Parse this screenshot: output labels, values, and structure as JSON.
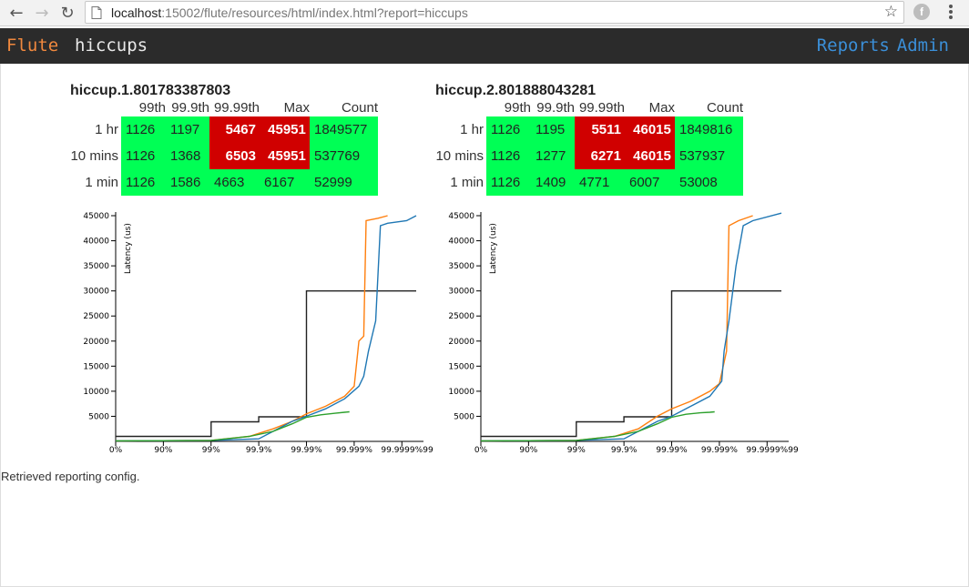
{
  "browser": {
    "url_host": "localhost",
    "url_rest": ":15002/flute/resources/html/index.html?report=hiccups",
    "ext_icon_glyph": "f"
  },
  "navbar": {
    "brand": "Flute",
    "report_name": "hiccups",
    "links": [
      "Reports",
      "Admin"
    ]
  },
  "stats_headers": [
    "99th",
    "99.9th",
    "99.99th",
    "Max",
    "Count"
  ],
  "panels": [
    {
      "title": "hiccup.1.801783387803",
      "rows": [
        {
          "label": "1 hr",
          "p99": "1126",
          "p999": "1197",
          "p9999": "5467",
          "max": "45951",
          "count": "1849577",
          "alarm": true
        },
        {
          "label": "10 mins",
          "p99": "1126",
          "p999": "1368",
          "p9999": "6503",
          "max": "45951",
          "count": "537769",
          "alarm": true
        },
        {
          "label": "1 min",
          "p99": "1126",
          "p999": "1586",
          "p9999": "4663",
          "max": "6167",
          "count": "52999",
          "alarm": false
        }
      ]
    },
    {
      "title": "hiccup.2.801888043281",
      "rows": [
        {
          "label": "1 hr",
          "p99": "1126",
          "p999": "1195",
          "p9999": "5511",
          "max": "46015",
          "count": "1849816",
          "alarm": true
        },
        {
          "label": "10 mins",
          "p99": "1126",
          "p999": "1277",
          "p9999": "6271",
          "max": "46015",
          "count": "537937",
          "alarm": true
        },
        {
          "label": "1 min",
          "p99": "1126",
          "p999": "1409",
          "p9999": "4771",
          "max": "6007",
          "count": "53008",
          "alarm": false
        }
      ]
    }
  ],
  "status_message": "Retrieved reporting config.",
  "colors": {
    "ok": "#00ff55",
    "alarm": "#d00000",
    "series_1hr": "#1f77b4",
    "series_10min": "#ff7f0e",
    "series_1min": "#2ca02c",
    "sla": "#222222"
  },
  "chart_data": [
    {
      "type": "line",
      "title": "",
      "ylabel": "Latency (us)",
      "x_scale": "log-percentile",
      "x_ticks": [
        "0%",
        "90%",
        "99%",
        "99.9%",
        "99.99%",
        "99.999%",
        "99.9999%",
        "99"
      ],
      "y_ticks": [
        5000,
        10000,
        15000,
        20000,
        25000,
        30000,
        35000,
        40000,
        45000
      ],
      "ylim": [
        0,
        45000
      ],
      "series": [
        {
          "color": "#222222",
          "points": [
            [
              0,
              1000
            ],
            [
              2,
              1000
            ],
            [
              2,
              3900
            ],
            [
              3,
              3900
            ],
            [
              3,
              4900
            ],
            [
              4,
              4900
            ],
            [
              4,
              30000
            ],
            [
              6.3,
              30000
            ]
          ]
        },
        {
          "color": "#ff7f0e",
          "points": [
            [
              0,
              100
            ],
            [
              2,
              200
            ],
            [
              2.8,
              1000
            ],
            [
              3.3,
              2500
            ],
            [
              3.7,
              4000
            ],
            [
              4,
              5500
            ],
            [
              4.4,
              7000
            ],
            [
              4.8,
              9000
            ],
            [
              5,
              11000
            ],
            [
              5.1,
              20000
            ],
            [
              5.2,
              21000
            ],
            [
              5.25,
              44000
            ],
            [
              5.5,
              44500
            ],
            [
              5.7,
              45000
            ]
          ]
        },
        {
          "color": "#1f77b4",
          "points": [
            [
              0,
              100
            ],
            [
              2,
              200
            ],
            [
              3,
              500
            ],
            [
              3.4,
              2500
            ],
            [
              3.7,
              4000
            ],
            [
              4,
              5000
            ],
            [
              4.4,
              6500
            ],
            [
              4.8,
              8500
            ],
            [
              5.1,
              11000
            ],
            [
              5.2,
              13000
            ],
            [
              5.3,
              18000
            ],
            [
              5.45,
              24000
            ],
            [
              5.55,
              43000
            ],
            [
              5.7,
              43500
            ],
            [
              6.1,
              44000
            ],
            [
              6.3,
              45000
            ]
          ]
        },
        {
          "color": "#2ca02c",
          "points": [
            [
              0,
              100
            ],
            [
              2,
              200
            ],
            [
              2.8,
              1000
            ],
            [
              3.3,
              2000
            ],
            [
              3.7,
              3500
            ],
            [
              4,
              4800
            ],
            [
              4.3,
              5300
            ],
            [
              4.6,
              5600
            ],
            [
              4.8,
              5800
            ],
            [
              4.9,
              5900
            ]
          ]
        }
      ]
    },
    {
      "type": "line",
      "title": "",
      "ylabel": "Latency (us)",
      "x_scale": "log-percentile",
      "x_ticks": [
        "0%",
        "90%",
        "99%",
        "99.9%",
        "99.99%",
        "99.999%",
        "99.9999%",
        "99"
      ],
      "y_ticks": [
        5000,
        10000,
        15000,
        20000,
        25000,
        30000,
        35000,
        40000,
        45000
      ],
      "ylim": [
        0,
        45000
      ],
      "series": [
        {
          "color": "#222222",
          "points": [
            [
              0,
              1000
            ],
            [
              2,
              1000
            ],
            [
              2,
              3900
            ],
            [
              3,
              3900
            ],
            [
              3,
              4900
            ],
            [
              4,
              4900
            ],
            [
              4,
              30000
            ],
            [
              6.3,
              30000
            ]
          ]
        },
        {
          "color": "#ff7f0e",
          "points": [
            [
              0,
              100
            ],
            [
              2,
              200
            ],
            [
              2.8,
              1000
            ],
            [
              3.3,
              2500
            ],
            [
              3.7,
              5000
            ],
            [
              4,
              6500
            ],
            [
              4.4,
              8000
            ],
            [
              4.8,
              10000
            ],
            [
              5,
              11500
            ],
            [
              5.15,
              18000
            ],
            [
              5.2,
              43000
            ],
            [
              5.4,
              44000
            ],
            [
              5.7,
              45000
            ]
          ]
        },
        {
          "color": "#1f77b4",
          "points": [
            [
              0,
              100
            ],
            [
              2,
              200
            ],
            [
              3,
              500
            ],
            [
              3.4,
              2500
            ],
            [
              3.7,
              4000
            ],
            [
              4,
              5000
            ],
            [
              4.4,
              7000
            ],
            [
              4.8,
              9000
            ],
            [
              5.05,
              12000
            ],
            [
              5.1,
              18000
            ],
            [
              5.2,
              24000
            ],
            [
              5.35,
              35000
            ],
            [
              5.5,
              43000
            ],
            [
              5.7,
              44000
            ],
            [
              6.3,
              45500
            ]
          ]
        },
        {
          "color": "#2ca02c",
          "points": [
            [
              0,
              100
            ],
            [
              2,
              200
            ],
            [
              2.8,
              1000
            ],
            [
              3.3,
              2000
            ],
            [
              3.7,
              3500
            ],
            [
              4,
              4800
            ],
            [
              4.3,
              5400
            ],
            [
              4.6,
              5700
            ],
            [
              4.8,
              5800
            ],
            [
              4.9,
              5900
            ]
          ]
        }
      ]
    }
  ]
}
